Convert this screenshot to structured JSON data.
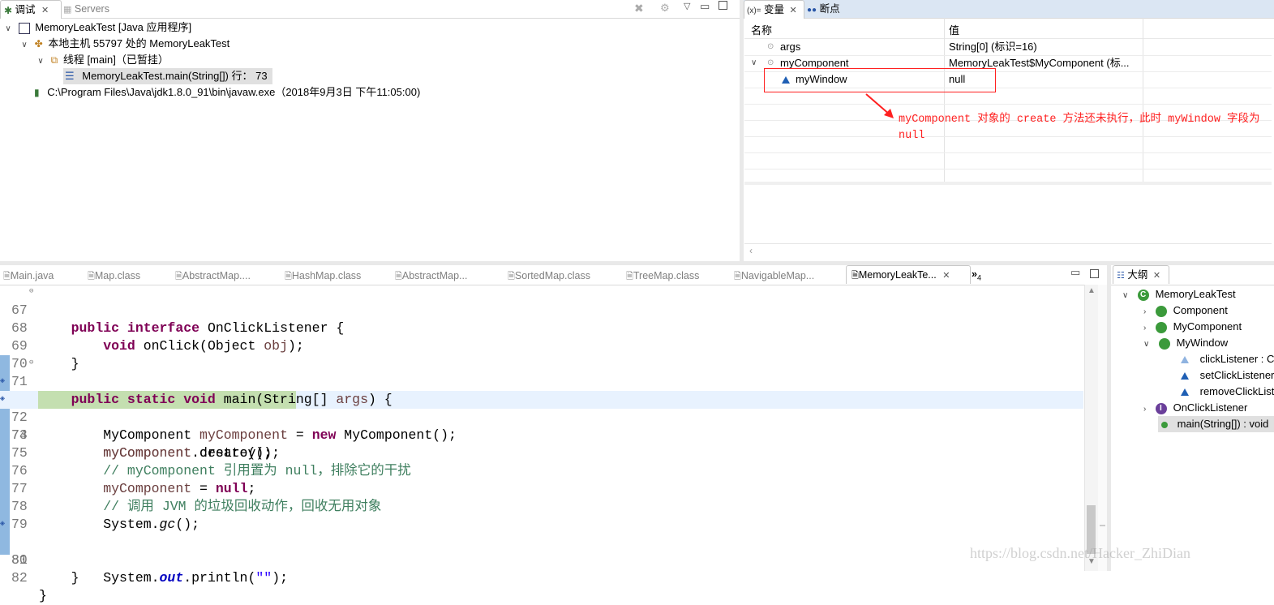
{
  "debug_view": {
    "tabs": [
      {
        "label": "调试",
        "active": true
      },
      {
        "label": "Servers",
        "active": false
      }
    ],
    "tree": [
      {
        "label": "MemoryLeakTest [Java 应用程序]"
      },
      {
        "label": "本地主机 55797 处的 MemoryLeakTest"
      },
      {
        "label": "线程 [main]（已暂挂）"
      },
      {
        "label": "MemoryLeakTest.main(String[]) 行： 73"
      },
      {
        "label": "C:\\Program Files\\Java\\jdk1.8.0_91\\bin\\javaw.exe（2018年9月3日 下午11:05:00)"
      }
    ]
  },
  "variables_view": {
    "tabs": [
      {
        "label": "变量",
        "prefix": "(x)=",
        "active": true
      },
      {
        "label": "断点",
        "active": false
      }
    ],
    "columns": [
      "名称",
      "值"
    ],
    "rows": [
      {
        "name": "args",
        "value": "String[0]   (标识=16)"
      },
      {
        "name": "myComponent",
        "value": "MemoryLeakTest$MyComponent   (标..."
      },
      {
        "name": "myWindow",
        "value": "null"
      }
    ],
    "annotation": "myComponent 对象的 create 方法还未执行，此时 myWindow 字段为 null",
    "annotation_color": "#ff0000"
  },
  "editor": {
    "tabs": [
      {
        "label": "Main.java"
      },
      {
        "label": "Map.class"
      },
      {
        "label": "AbstractMap...."
      },
      {
        "label": "HashMap.class"
      },
      {
        "label": "AbstractMap..."
      },
      {
        "label": "SortedMap.class"
      },
      {
        "label": "TreeMap.class"
      },
      {
        "label": "NavigableMap..."
      },
      {
        "label": "MemoryLeakTe...",
        "active": true
      }
    ],
    "overflow_count": "4",
    "overflow_chevron": "»",
    "current_line": "73",
    "code": {
      "l67": "67",
      "l68": "68",
      "l69": "69",
      "l70": "70",
      "l71": "71",
      "l72": "72",
      "l73": "73",
      "l74": "74",
      "l75": "75",
      "l76": "76",
      "l77": "77",
      "l78": "78",
      "l79": "79",
      "l80": "80",
      "l81": "81",
      "l82": "82",
      "c67_kw": "public interface",
      "c67_rest": " OnClickListener {",
      "c68_kw": "void",
      "c68_a": " onClick(Object ",
      "c68_p": "obj",
      "c68_b": ");",
      "c69": "}",
      "c71_kw": "public static void",
      "c71_a": " main(String[] ",
      "c71_p": "args",
      "c71_b": ") {",
      "c72_a": "MyComponent ",
      "c72_p": "myComponent",
      "c72_b": " = ",
      "c72_kw": "new",
      "c72_c": " MyComponent();",
      "c73_p": "myComponent",
      "c73_b": ".create();",
      "c74_p": "myComponent",
      "c74_b": ".destroy();",
      "c75": "// myComponent 引用置为 null，排除它的干扰",
      "c76_p": "myComponent",
      "c76_b": " = ",
      "c76_kw": "null",
      "c76_c": ";",
      "c77": "// 调用 JVM 的垃圾回收动作，回收无用对象",
      "c78_a": "System.",
      "c78_m": "gc",
      "c78_b": "();",
      "c80_a": "System.",
      "c80_f": "out",
      "c80_b": ".println(",
      "c80_s": "\"\"",
      "c80_c": ");",
      "c81": "}",
      "c82": "}"
    }
  },
  "outline_view": {
    "tab": "大纲",
    "items": [
      {
        "label": "MemoryLeakTest"
      },
      {
        "label": "Component"
      },
      {
        "label": "MyComponent"
      },
      {
        "label": "MyWindow"
      },
      {
        "label": "clickListener : C"
      },
      {
        "label": "setClickListener"
      },
      {
        "label": "removeClickList"
      },
      {
        "label": "OnClickListener"
      },
      {
        "label": "main(String[]) : void"
      }
    ]
  },
  "watermark": "https://blog.csdn.net/Hacker_ZhiDian",
  "colors": {
    "current_line": "#c4dfb0",
    "cursor_line": "#e8f2fe",
    "accent_blue": "#1f5fb4"
  }
}
